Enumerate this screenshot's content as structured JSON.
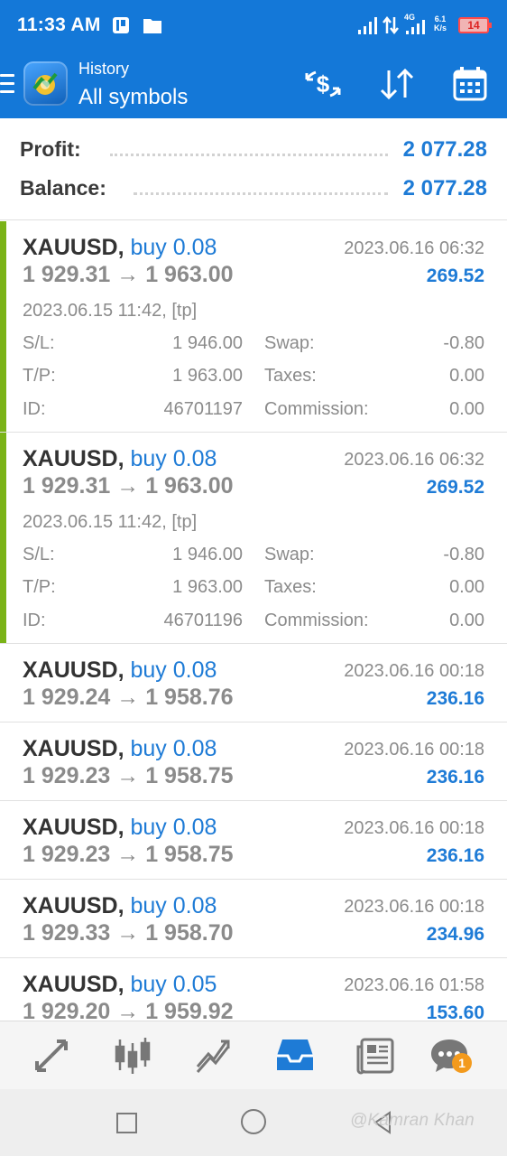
{
  "status_bar": {
    "time": "11:33 AM",
    "network_type": "4G",
    "speed_value": "6.1",
    "speed_unit": "K/s",
    "battery": "14"
  },
  "app_bar": {
    "subtitle": "History",
    "title": "All symbols",
    "icons": [
      "menu-icon",
      "metatrader-logo",
      "currency-exchange-icon",
      "sort-icon",
      "calendar-icon"
    ]
  },
  "summary": {
    "profit_label": "Profit:",
    "profit_value": "2 077.28",
    "balance_label": "Balance:",
    "balance_value": "2 077.28"
  },
  "labels": {
    "sl": "S/L:",
    "tp": "T/P:",
    "id": "ID:",
    "swap": "Swap:",
    "taxes": "Taxes:",
    "commission": "Commission:"
  },
  "deals": [
    {
      "symbol": "XAUUSD,",
      "side": "buy 0.08",
      "close_time": "2023.06.16 06:32",
      "prices": "1 929.31 → 1 963.00",
      "profit": "269.52",
      "open_info": "2023.06.15 11:42, [tp]",
      "sl": "1 946.00",
      "tp": "1 963.00",
      "id": "46701197",
      "swap": "-0.80",
      "taxes": "0.00",
      "commission": "0.00"
    },
    {
      "symbol": "XAUUSD,",
      "side": "buy 0.08",
      "close_time": "2023.06.16 06:32",
      "prices": "1 929.31 → 1 963.00",
      "profit": "269.52",
      "open_info": "2023.06.15 11:42, [tp]",
      "sl": "1 946.00",
      "tp": "1 963.00",
      "id": "46701196",
      "swap": "-0.80",
      "taxes": "0.00",
      "commission": "0.00"
    },
    {
      "symbol": "XAUUSD,",
      "side": "buy 0.08",
      "close_time": "2023.06.16 00:18",
      "prices": "1 929.24 → 1 958.76",
      "profit": "236.16"
    },
    {
      "symbol": "XAUUSD,",
      "side": "buy 0.08",
      "close_time": "2023.06.16 00:18",
      "prices": "1 929.23 → 1 958.75",
      "profit": "236.16"
    },
    {
      "symbol": "XAUUSD,",
      "side": "buy 0.08",
      "close_time": "2023.06.16 00:18",
      "prices": "1 929.23 → 1 958.75",
      "profit": "236.16"
    },
    {
      "symbol": "XAUUSD,",
      "side": "buy 0.08",
      "close_time": "2023.06.16 00:18",
      "prices": "1 929.33 → 1 958.70",
      "profit": "234.96"
    },
    {
      "symbol": "XAUUSD,",
      "side": "buy 0.05",
      "close_time": "2023.06.16 01:58",
      "prices": "1 929.20 → 1 959.92",
      "profit": "153.60"
    }
  ],
  "bottom_nav": {
    "items": [
      "quotes-icon",
      "chart-icon",
      "trade-icon",
      "history-icon",
      "news-icon",
      "chat-icon"
    ],
    "active": "history-icon",
    "chat_badge": "1"
  },
  "watermark": "@Kamran Khan",
  "colors": {
    "primary": "#1478d8",
    "profit_blue": "#1e7bd6",
    "accent_green": "#7ab317",
    "badge_orange": "#f39a1d"
  }
}
